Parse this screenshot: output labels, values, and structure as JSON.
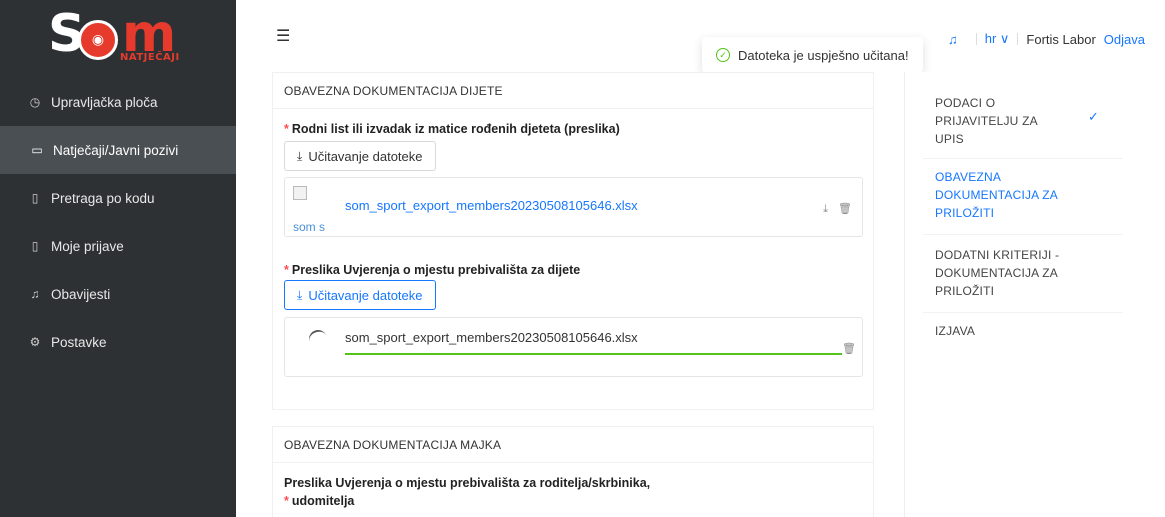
{
  "logo": {
    "text_s": "S",
    "text_o": "◉",
    "text_m": "m",
    "sub": "NATJEČAJI"
  },
  "sidebar": {
    "items": [
      {
        "label": "Upravljačka ploča",
        "icon": "dashboard-icon",
        "glyph": "◷"
      },
      {
        "label": "Natječaji/Javni pozivi",
        "icon": "folder-icon",
        "glyph": "▭"
      },
      {
        "label": "Pretraga po kodu",
        "icon": "file-search-icon",
        "glyph": "▯"
      },
      {
        "label": "Moje prijave",
        "icon": "file-check-icon",
        "glyph": "▯"
      },
      {
        "label": "Obavijesti",
        "icon": "bell-icon",
        "glyph": "♫"
      },
      {
        "label": "Postavke",
        "icon": "gear-icon",
        "glyph": "⚙"
      }
    ]
  },
  "topbar": {
    "menu_glyph": "☰",
    "toast": "Datoteka je uspješno učitana!",
    "lang": "hr ∨",
    "user": "Fortis Labor",
    "logout": "Odjava"
  },
  "section_child": {
    "title": "OBAVEZNA DOKUMENTACIJA DIJETE",
    "field1": {
      "label": "Rodni list ili izvadak iz matice rođenih djeteta (preslika)",
      "button": "Učitavanje datoteke",
      "file_name": "som_sport_export_members20230508105646.xlsx",
      "thumb_alt": "som  s"
    },
    "field2": {
      "label": "Preslika Uvjerenja o mjestu prebivališta za dijete",
      "button": "Učitavanje datoteke",
      "file_name": "som_sport_export_members20230508105646.xlsx"
    }
  },
  "section_mother": {
    "title": "OBAVEZNA DOKUMENTACIJA MAJKA",
    "field1": {
      "label_line1": "Preslika Uvjerenja o mjestu prebivališta za roditelja/skrbinika,",
      "label_line2": "udomitelja"
    }
  },
  "steps": [
    {
      "label": "PODACI O PRIJAVITELJU ZA UPIS",
      "done": true
    },
    {
      "label": "OBAVEZNA DOKUMENTACIJA ZA PRILOŽITI",
      "active": true
    },
    {
      "label": "DODATNI KRITERIJI -DOKUMENTACIJA ZA PRILOŽITI"
    },
    {
      "label": "IZJAVA"
    }
  ],
  "colors": {
    "accent": "#1677ff",
    "sidebar_bg": "#2e3134",
    "sidebar_active": "#4a4f54",
    "success": "#52c41a",
    "required": "#ff4d4f",
    "brand_red": "#e63a2c"
  }
}
